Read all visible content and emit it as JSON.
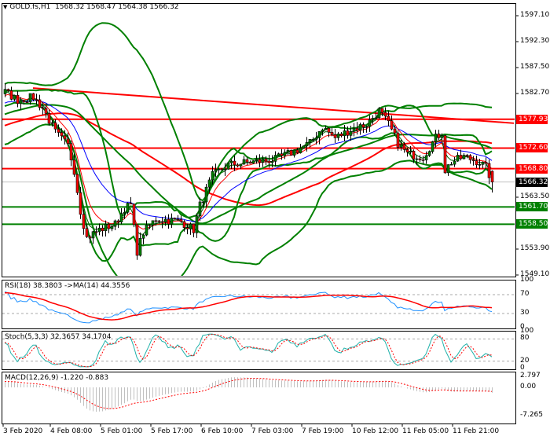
{
  "header": {
    "arrow_icon": "triangle-down-icon",
    "symbol": "GOLD.fs,H1",
    "ohlc": "1568.32 1568.47 1564.38 1566.32"
  },
  "price_axis": {
    "ticks": [
      1597.1,
      1592.3,
      1587.5,
      1582.7,
      1563.5,
      1553.9,
      1549.1
    ],
    "range": [
      1549.1,
      1597.1
    ]
  },
  "levels": [
    {
      "price": 1577.93,
      "label": "1577.93",
      "color": "#ff0000"
    },
    {
      "price": 1572.6,
      "label": "1572.60",
      "color": "#ff0000"
    },
    {
      "price": 1568.8,
      "label": "1568.80",
      "color": "#ff0000"
    },
    {
      "price": 1561.7,
      "label": "1561.70",
      "color": "#008000"
    },
    {
      "price": 1558.5,
      "label": "1558.50",
      "color": "#008000"
    }
  ],
  "current_price": {
    "price": 1566.32,
    "label": "1566.32",
    "color": "#000000"
  },
  "trendline": {
    "from": {
      "bar": 9,
      "price": 1583.7
    },
    "to": {
      "bar": 162,
      "price": 1577.2
    },
    "color": "#ff0000"
  },
  "time_axis": [
    {
      "bar": 0,
      "label": "3 Feb 2020"
    },
    {
      "bar": 15,
      "label": "4 Feb 08:00"
    },
    {
      "bar": 31,
      "label": "5 Feb 01:00"
    },
    {
      "bar": 47,
      "label": "5 Feb 17:00"
    },
    {
      "bar": 63,
      "label": "6 Feb 10:00"
    },
    {
      "bar": 79,
      "label": "7 Feb 03:00"
    },
    {
      "bar": 95,
      "label": "7 Feb 19:00"
    },
    {
      "bar": 111,
      "label": "10 Feb 12:00"
    },
    {
      "bar": 127,
      "label": "11 Feb 05:00"
    },
    {
      "bar": 143,
      "label": "11 Feb 21:00"
    }
  ],
  "indicators": {
    "rsi": {
      "label": "RSI(18) 38.3803  ->MA(14) 44.3556",
      "ticks": [
        "100",
        "70",
        "30",
        "0"
      ],
      "levels": [
        70,
        30
      ]
    },
    "stoch": {
      "label": "Stoch(5,3,3) 32.3657 34.1704",
      "ticks": [
        "100",
        "80",
        "20",
        "0"
      ],
      "levels": [
        80,
        20
      ]
    },
    "macd": {
      "label": "MACD(12,26,9) -1.220 -0.883",
      "ticks": [
        "2.797",
        "0.00",
        "-7.265"
      ],
      "range": [
        -7.265,
        2.797
      ]
    }
  },
  "colors": {
    "up": "#008000",
    "down": "#ff0000",
    "bands": "#008000",
    "fast_ma": "#ff0000",
    "slow_ma": "#0000ff",
    "rsi": "#1e90ff",
    "stoch": "#20b2aa",
    "signal": "#ff0000",
    "hist": "#c0c0c0"
  },
  "chart_data": {
    "type": "candlestick",
    "title": "GOLD.fs,H1",
    "bars": 156,
    "close_path": [
      [
        0,
        1583.0
      ],
      [
        4,
        1581.5
      ],
      [
        9,
        1582.0
      ],
      [
        12,
        1580.0
      ],
      [
        16,
        1575.5
      ],
      [
        20,
        1573.0
      ],
      [
        22,
        1568.5
      ],
      [
        24,
        1561.0
      ],
      [
        26,
        1556.0
      ],
      [
        30,
        1557.5
      ],
      [
        35,
        1558.5
      ],
      [
        38,
        1561.5
      ],
      [
        40,
        1562.0
      ],
      [
        42,
        1553.5
      ],
      [
        44,
        1557.0
      ],
      [
        48,
        1559.5
      ],
      [
        56,
        1559.0
      ],
      [
        60,
        1557.5
      ],
      [
        62,
        1562.0
      ],
      [
        66,
        1567.5
      ],
      [
        71,
        1569.5
      ],
      [
        78,
        1570.0
      ],
      [
        86,
        1570.5
      ],
      [
        92,
        1572.0
      ],
      [
        97,
        1573.5
      ],
      [
        101,
        1576.5
      ],
      [
        105,
        1574.5
      ],
      [
        110,
        1576.0
      ],
      [
        115,
        1577.0
      ],
      [
        119,
        1579.5
      ],
      [
        122,
        1577.0
      ],
      [
        125,
        1573.5
      ],
      [
        128,
        1571.5
      ],
      [
        133,
        1571.0
      ],
      [
        137,
        1574.5
      ],
      [
        139,
        1575.5
      ],
      [
        140,
        1568.5
      ],
      [
        142,
        1570.0
      ],
      [
        146,
        1571.0
      ],
      [
        151,
        1570.0
      ],
      [
        153,
        1569.0
      ],
      [
        155,
        1566.32
      ]
    ],
    "last_ohlc": {
      "open": 1568.32,
      "high": 1568.47,
      "low": 1564.38,
      "close": 1566.32
    }
  }
}
